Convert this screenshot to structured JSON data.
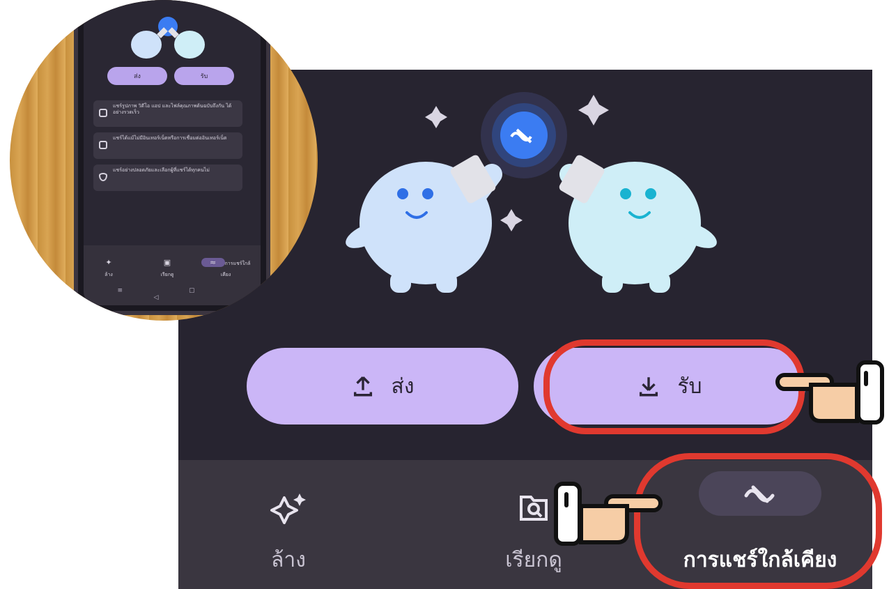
{
  "panel": {
    "actions": {
      "send_label": "ส่ง",
      "receive_label": "รับ"
    },
    "nav": {
      "items": [
        {
          "label": "ล้าง",
          "icon": "sparkle-icon"
        },
        {
          "label": "เรียกดู",
          "icon": "folder-search-icon"
        },
        {
          "label": "การแชร์ใกล้เคียง",
          "icon": "nearby-share-icon",
          "active": true
        }
      ]
    }
  },
  "photo": {
    "mini_buttons": {
      "send_label": "ส่ง",
      "receive_label": "รับ"
    },
    "mini_cards": [
      {
        "text": "แชร์รูปภาพ วิดีโอ แอป และไฟล์คุณภาพต้นฉบับถึงกัน ได้อย่างรวดเร็ว"
      },
      {
        "text": "แชร์ได้แม้ไม่มีอินเทอร์เน็ตหรือการเชื่อมต่ออินเทอร์เน็ต"
      },
      {
        "text": "แชร์อย่างปลอดภัยและเลือกผู้ที่แชร์ได้ทุกคนไม่"
      }
    ],
    "mini_nav": [
      {
        "label": "ล้าง"
      },
      {
        "label": "เรียกดู"
      },
      {
        "label": "การแชร์ใกล้เคียง"
      }
    ],
    "system_nav": "≡ ▢ ◁"
  },
  "colors": {
    "panel_bg": "#272430",
    "accent_pill": "#cbb6f7",
    "nearby_blue": "#3b7cf2",
    "highlight_ring": "#e0392f"
  }
}
